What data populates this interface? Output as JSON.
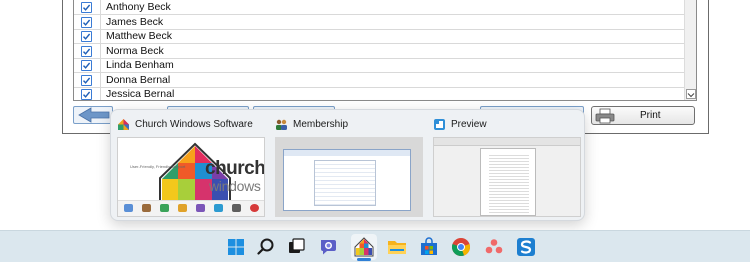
{
  "member_list": {
    "rows": [
      {
        "name": "Anthony Beck",
        "checked": true
      },
      {
        "name": "James Beck",
        "checked": true
      },
      {
        "name": "Matthew Beck",
        "checked": true
      },
      {
        "name": "Norma Beck",
        "checked": true
      },
      {
        "name": "Linda Benham",
        "checked": true
      },
      {
        "name": "Donna Bernal",
        "checked": true
      },
      {
        "name": "Jessica Bernal",
        "checked": true
      }
    ]
  },
  "toolbar": {
    "print_label": "Print"
  },
  "thumbnails": [
    {
      "title": "Church Windows Software",
      "icon": "church-windows-app-icon"
    },
    {
      "title": "Membership",
      "icon": "membership-app-icon"
    },
    {
      "title": "Preview",
      "icon": "preview-app-icon"
    }
  ],
  "church_windows_splash": {
    "word1": "church",
    "word2": "windows",
    "tagline": "User-Friendly, Friendly Support"
  },
  "taskbar": {
    "icons": [
      "start-icon",
      "search-icon",
      "task-view-icon",
      "teams-chat-icon",
      "church-windows-taskbar-icon",
      "file-explorer-icon",
      "microsoft-store-icon",
      "chrome-icon",
      "asana-icon",
      "snagit-icon"
    ]
  },
  "colors": {
    "checkbox_accent": "#3a7bd5",
    "taskbar_bg": "#dbe7ee",
    "popup_bg": "#eef1f4"
  }
}
